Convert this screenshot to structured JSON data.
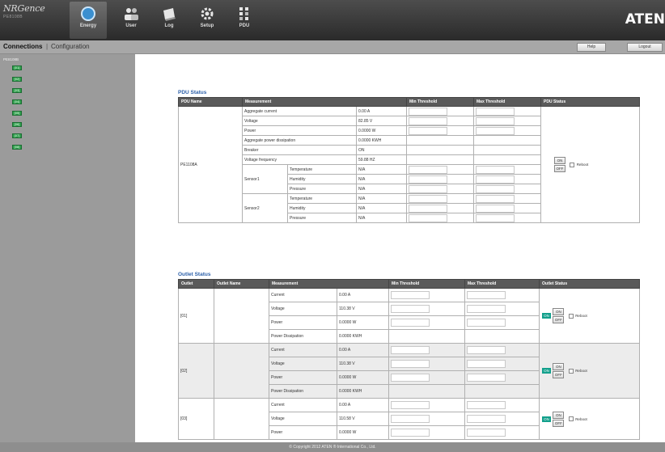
{
  "brand": {
    "logo": "NRGence",
    "model": "PE8108B",
    "vendor": "ATEN"
  },
  "nav": {
    "tabs": [
      {
        "label": "Energy",
        "icon": "energy-icon",
        "active": true
      },
      {
        "label": "User",
        "icon": "user-icon",
        "active": false
      },
      {
        "label": "Log",
        "icon": "log-icon",
        "active": false
      },
      {
        "label": "Setup",
        "icon": "setup-icon",
        "active": false
      },
      {
        "label": "PDU",
        "icon": "pdu-icon",
        "active": false
      }
    ]
  },
  "subbar": {
    "connections": "Connections",
    "separator": "|",
    "configuration": "Configuration",
    "help": "Help",
    "logout": "Logout"
  },
  "sidebar": {
    "root": "PE8108B",
    "items": [
      "[01]",
      "[02]",
      "[03]",
      "[04]",
      "[05]",
      "[06]",
      "[07]",
      "[08]"
    ]
  },
  "pdu_status": {
    "title": "PDU Status",
    "headers": [
      "PDU Name",
      "Measurement",
      "Min Threshold",
      "Max Threshold",
      "PDU Status"
    ],
    "pdu_name": "PE1108A",
    "rows": [
      {
        "label": "Aggregate current",
        "value": "0.00 A"
      },
      {
        "label": "Voltage",
        "value": "82.85 V"
      },
      {
        "label": "Power",
        "value": "0.0000 W"
      },
      {
        "label": "Aggregate power dissipation",
        "value": "0.0000 KWH"
      },
      {
        "label": "Breaker",
        "value": "ON"
      },
      {
        "label": "Voltage frequency",
        "value": "59.88 HZ"
      }
    ],
    "sensors": [
      {
        "name": "Sensor1",
        "rows": [
          {
            "label": "Temperature",
            "value": "N/A"
          },
          {
            "label": "Humidity",
            "value": "N/A"
          },
          {
            "label": "Pressure",
            "value": "N/A"
          }
        ]
      },
      {
        "name": "Sensor2",
        "rows": [
          {
            "label": "Temperature",
            "value": "N/A"
          },
          {
            "label": "Humidity",
            "value": "N/A"
          },
          {
            "label": "Pressure",
            "value": "N/A"
          }
        ]
      }
    ],
    "on": "ON",
    "off": "OFF",
    "reboot": "Reboot"
  },
  "outlet_status": {
    "title": "Outlet Status",
    "headers": [
      "Outlet",
      "Outlet Name",
      "Measurement",
      "Min Threshold",
      "Max Threshold",
      "Outlet Status"
    ],
    "outlets": [
      {
        "id": "[01]",
        "rows": [
          {
            "label": "Current",
            "value": "0.00 A"
          },
          {
            "label": "Voltage",
            "value": "110.38 V"
          },
          {
            "label": "Power",
            "value": "0.0000 W"
          },
          {
            "label": "Power Dissipation",
            "value": "0.0000 KWH"
          }
        ],
        "state": "ON"
      },
      {
        "id": "[02]",
        "rows": [
          {
            "label": "Current",
            "value": "0.00 A"
          },
          {
            "label": "Voltage",
            "value": "110.38 V"
          },
          {
            "label": "Power",
            "value": "0.0000 W"
          },
          {
            "label": "Power Dissipation",
            "value": "0.0000 KWH"
          }
        ],
        "state": "ON"
      },
      {
        "id": "[03]",
        "rows": [
          {
            "label": "Current",
            "value": "0.00 A"
          },
          {
            "label": "Voltage",
            "value": "110.58 V"
          },
          {
            "label": "Power",
            "value": "0.0000 W"
          }
        ],
        "state": "ON"
      }
    ],
    "on": "ON",
    "off": "OFF",
    "reboot": "Reboot"
  },
  "footer": {
    "copyright": "© Copyright 2012 ATEN ® International Co., Ltd."
  },
  "colors": {
    "accent_blue": "#2a5ea8",
    "on_badge": "#13a08c",
    "tree_green": "#2d9c4b"
  }
}
